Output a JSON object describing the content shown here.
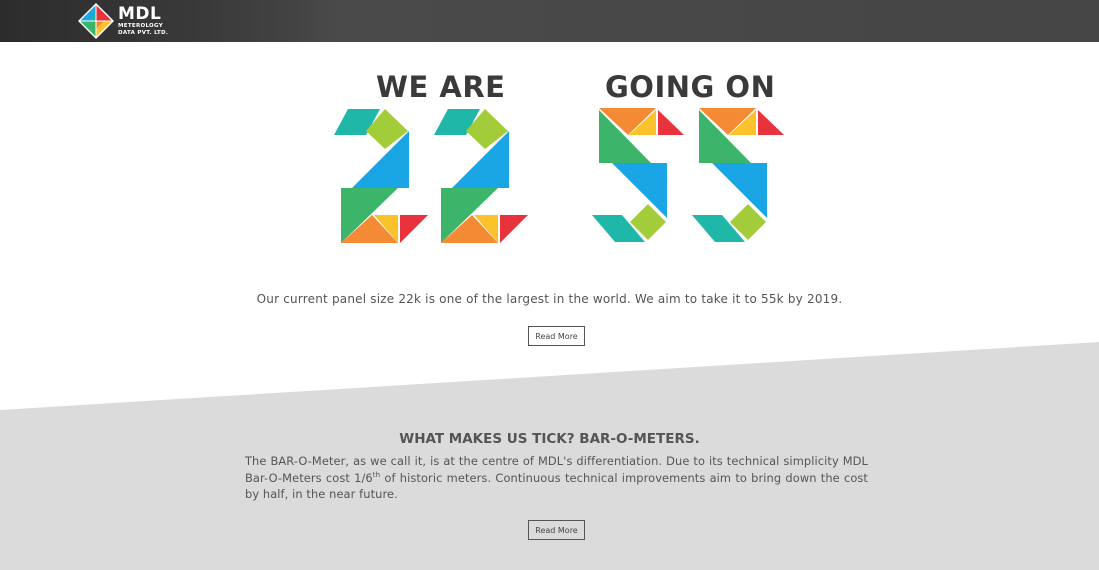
{
  "header": {
    "logo_name": "MDL",
    "logo_sub_line1": "METEROLOGY",
    "logo_sub_line2": "DATA PVT. LTD."
  },
  "hero": {
    "left_heading": "WE ARE",
    "right_heading": "GOING ON",
    "left_number": "22",
    "right_number": "55",
    "description": "Our current panel size 22k is one of the largest in the world. We aim to take it to 55k by 2019.",
    "read_more_label": "Read More"
  },
  "ticker_section": {
    "heading": "WHAT MAKES US TICK? BAR-O-METERS.",
    "text_part1": "The BAR-O-Meter, as we call it, is at the centre of MDL's differentiation. Due to its technical simplicity MDL Bar-O-Meters cost 1/6",
    "text_sup": "th",
    "text_part2": " of historic meters. Continuous technical improvements aim to bring down the cost by half, in the near future.",
    "read_more_label": "Read More"
  },
  "colors": {
    "teal": "#1fb8a8",
    "lime": "#a3cc3b",
    "blue": "#1aa5e4",
    "green": "#3cb46a",
    "orange": "#f58a34",
    "yellow": "#fcc22c",
    "red": "#e8323c",
    "band_grey": "#dcdbdc",
    "topbar": "#444444"
  }
}
